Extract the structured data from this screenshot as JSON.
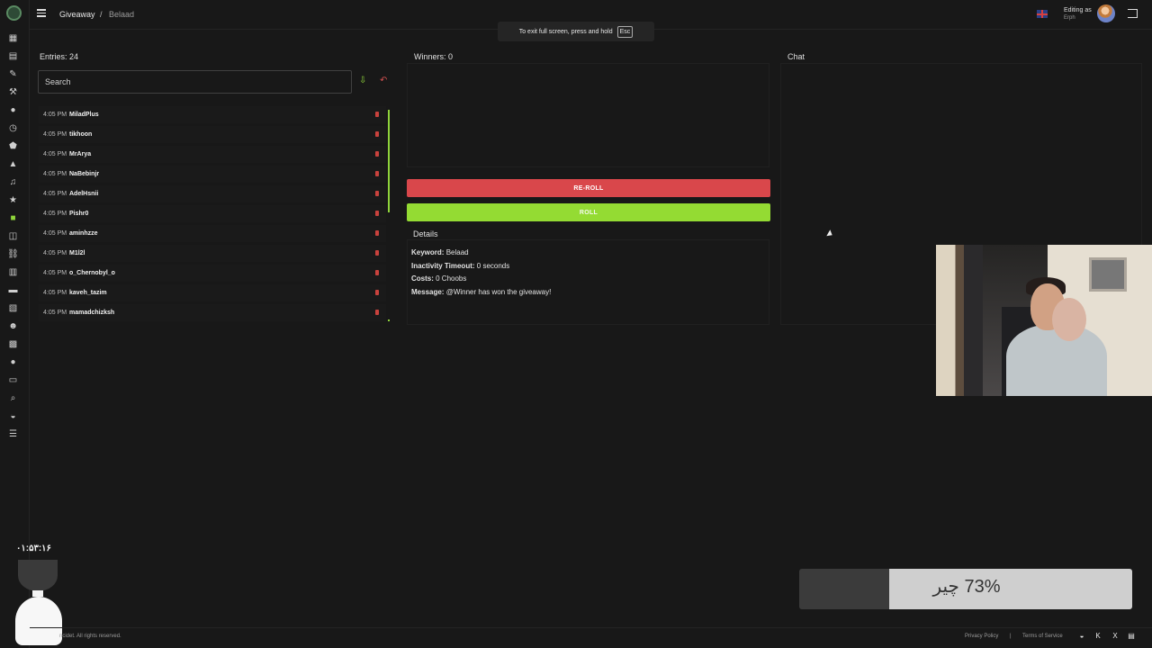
{
  "topbar": {
    "breadcrumb_parent": "Giveaway",
    "breadcrumb_separator": "/",
    "breadcrumb_current": "Belaad",
    "fullscreen_notice": "To exit full screen, press and hold",
    "escape_key": "Esc",
    "editing_label": "Editing as",
    "editing_user": "Erph"
  },
  "entries": {
    "title": "Entries: 24",
    "search_placeholder": "Search",
    "items": [
      {
        "time": "4:05 PM",
        "name": "MiladPlus"
      },
      {
        "time": "4:05 PM",
        "name": "tikhoon"
      },
      {
        "time": "4:05 PM",
        "name": "MrArya"
      },
      {
        "time": "4:05 PM",
        "name": "NaBebinjr"
      },
      {
        "time": "4:05 PM",
        "name": "AdelHsnii"
      },
      {
        "time": "4:05 PM",
        "name": "Pishr0"
      },
      {
        "time": "4:05 PM",
        "name": "aminhzze"
      },
      {
        "time": "4:05 PM",
        "name": "M1l2l"
      },
      {
        "time": "4:05 PM",
        "name": "o_Chernobyl_o"
      },
      {
        "time": "4:05 PM",
        "name": "kaveh_tazim"
      },
      {
        "time": "4:05 PM",
        "name": "mamadchizksh"
      }
    ]
  },
  "winners": {
    "title": "Winners: 0",
    "reroll_label": "RE-ROLL",
    "roll_label": "ROLL"
  },
  "details": {
    "title": "Details",
    "keyword_label": "Keyword:",
    "keyword_value": "Belaad",
    "inactivity_label": "Inactivity Timeout:",
    "inactivity_value": "0 seconds",
    "costs_label": "Costs:",
    "costs_value": "0 Choobs",
    "message_label": "Message:",
    "message_value": "@Winner has won the giveaway!"
  },
  "chat": {
    "title": "Chat"
  },
  "overlay": {
    "timer_text": "۰۱:۵۳:۱۶",
    "progress_text": "73% چیر",
    "progress_fill": 0.73
  },
  "footer": {
    "copyright": "ncidet. All rights reserved.",
    "privacy": "Privacy Policy",
    "separator": "|",
    "terms": "Terms of Service"
  },
  "colors": {
    "accent": "#8fd43b",
    "danger": "#d9474b",
    "background": "#181818"
  }
}
